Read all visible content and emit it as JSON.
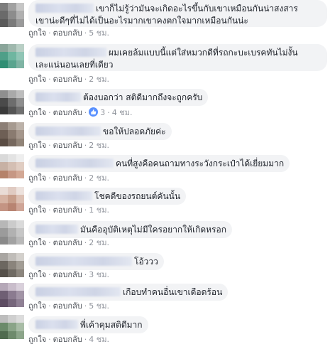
{
  "actions": {
    "like_label": "ถูกใจ",
    "reply_label": "ตอบกลับ",
    "separator": "·"
  },
  "comments": [
    {
      "text": "เขาก็ไม่รู้ว่ามันจะเกิดอะไรขึ้นกับเขาเหมือนกันน่าสงสาร เขาน่ะดีๆที่ไม่ได้เป็นอะไรมากเขาคงตกใจมากเหมือนกันน่ะ",
      "line1": "เขาก็ไม่รู้ว่ามันจะเกิดอะไรขึ้นกับเขาเหมือนกันน่าสงสาร",
      "line2": "เขาน่ะดีๆที่ไม่ได้เป็นอะไรมากเขาคงตกใจมากเหมือนกันน่ะ",
      "time": "5 ชม."
    },
    {
      "text": "ผมเคยล้มแบบนี้แต่ใส่หมวกดีที่รถกะบะเบรคทันไม่งั้น เละแน่นอนเลยที่เดียว",
      "line1": "ผมเคยล้มแบบนี้แต่ใส่หมวกดีที่รถกะบะเบรคทันไม่งั้น",
      "line2": "เละแน่นอนเลยที่เดียว",
      "time": "2 ชม."
    },
    {
      "text": "ต้องบอกว่า สติดีมากถึงจะถูกครับ",
      "time": "4 ชม.",
      "likes": "3"
    },
    {
      "text": "ขอให้ปลอดภัยค่ะ",
      "time": "2 ชม."
    },
    {
      "text": "คนที่สูงคือคนถามทางระวังกระเป๋าได้เยี่ยมมาก",
      "time": "2 ชม."
    },
    {
      "text": "โชคดีของรถยนต์คันนั้น",
      "time": "1 ชม."
    },
    {
      "text": "มันคืออุบัติเหตุไม่มีใครอยากให้เกิดหรอก",
      "time": "2 ชม."
    },
    {
      "text": "โอ้ววว",
      "time": "3 ชม."
    },
    {
      "text": "เกือบทำคนอื่นเขาเดือดร้อน",
      "time": "5 ชม."
    },
    {
      "text": "พี่เค้าคุมสติดีมาก",
      "time": "4 ชม."
    }
  ],
  "colors": {
    "bubble": "#f2f3f5",
    "like_badge": "#5890ff",
    "meta_text": "#90949c"
  }
}
